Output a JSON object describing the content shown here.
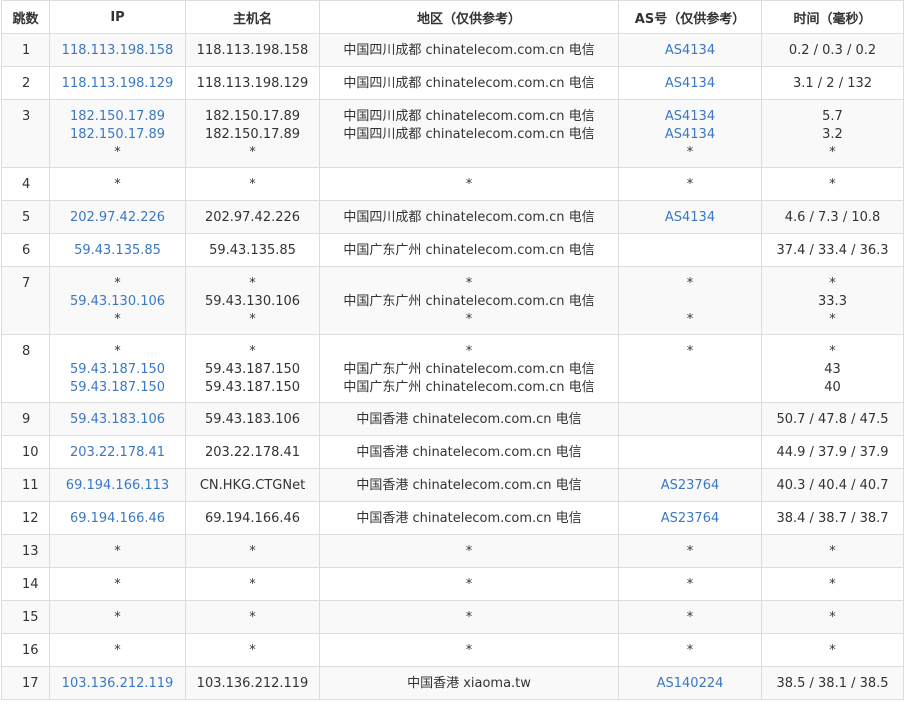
{
  "columns": [
    "跳数",
    "IP",
    "主机名",
    "地区（仅供参考）",
    "AS号（仅供参考）",
    "时间（毫秒）"
  ],
  "rows": [
    {
      "hop": "1",
      "ip": [
        "118.113.198.158"
      ],
      "host": [
        "118.113.198.158"
      ],
      "region": [
        "中国四川成都 chinatelecom.com.cn 电信"
      ],
      "as": [
        "AS4134"
      ],
      "time": [
        "0.2 / 0.3 / 0.2"
      ]
    },
    {
      "hop": "2",
      "ip": [
        "118.113.198.129"
      ],
      "host": [
        "118.113.198.129"
      ],
      "region": [
        "中国四川成都 chinatelecom.com.cn 电信"
      ],
      "as": [
        "AS4134"
      ],
      "time": [
        "3.1 / 2 / 132"
      ]
    },
    {
      "hop": "3",
      "ip": [
        "182.150.17.89",
        "182.150.17.89",
        "*"
      ],
      "host": [
        "182.150.17.89",
        "182.150.17.89",
        "*"
      ],
      "region": [
        "中国四川成都 chinatelecom.com.cn 电信",
        "中国四川成都 chinatelecom.com.cn 电信",
        ""
      ],
      "as": [
        "AS4134",
        "AS4134",
        "*"
      ],
      "time": [
        "5.7",
        "3.2",
        "*"
      ]
    },
    {
      "hop": "4",
      "ip": [
        "*"
      ],
      "host": [
        "*"
      ],
      "region": [
        "*"
      ],
      "as": [
        "*"
      ],
      "time": [
        "*"
      ]
    },
    {
      "hop": "5",
      "ip": [
        "202.97.42.226"
      ],
      "host": [
        "202.97.42.226"
      ],
      "region": [
        "中国四川成都 chinatelecom.com.cn 电信"
      ],
      "as": [
        "AS4134"
      ],
      "time": [
        "4.6 / 7.3 / 10.8"
      ]
    },
    {
      "hop": "6",
      "ip": [
        "59.43.135.85"
      ],
      "host": [
        "59.43.135.85"
      ],
      "region": [
        "中国广东广州 chinatelecom.com.cn 电信"
      ],
      "as": [
        ""
      ],
      "time": [
        "37.4 / 33.4 / 36.3"
      ]
    },
    {
      "hop": "7",
      "ip": [
        "*",
        "59.43.130.106",
        "*"
      ],
      "host": [
        "*",
        "59.43.130.106",
        "*"
      ],
      "region": [
        "*",
        "中国广东广州 chinatelecom.com.cn 电信",
        "*"
      ],
      "as": [
        "*",
        "",
        "*"
      ],
      "time": [
        "*",
        "33.3",
        "*"
      ]
    },
    {
      "hop": "8",
      "ip": [
        "*",
        "59.43.187.150",
        "59.43.187.150"
      ],
      "host": [
        "*",
        "59.43.187.150",
        "59.43.187.150"
      ],
      "region": [
        "*",
        "中国广东广州 chinatelecom.com.cn 电信",
        "中国广东广州 chinatelecom.com.cn 电信"
      ],
      "as": [
        "*",
        "",
        ""
      ],
      "time": [
        "*",
        "43",
        "40"
      ]
    },
    {
      "hop": "9",
      "ip": [
        "59.43.183.106"
      ],
      "host": [
        "59.43.183.106"
      ],
      "region": [
        "中国香港 chinatelecom.com.cn 电信"
      ],
      "as": [
        ""
      ],
      "time": [
        "50.7 / 47.8 / 47.5"
      ]
    },
    {
      "hop": "10",
      "ip": [
        "203.22.178.41"
      ],
      "host": [
        "203.22.178.41"
      ],
      "region": [
        "中国香港 chinatelecom.com.cn 电信"
      ],
      "as": [
        ""
      ],
      "time": [
        "44.9 / 37.9 / 37.9"
      ]
    },
    {
      "hop": "11",
      "ip": [
        "69.194.166.113"
      ],
      "host": [
        "CN.HKG.CTGNet"
      ],
      "region": [
        "中国香港 chinatelecom.com.cn 电信"
      ],
      "as": [
        "AS23764"
      ],
      "time": [
        "40.3 / 40.4 / 40.7"
      ]
    },
    {
      "hop": "12",
      "ip": [
        "69.194.166.46"
      ],
      "host": [
        "69.194.166.46"
      ],
      "region": [
        "中国香港 chinatelecom.com.cn 电信"
      ],
      "as": [
        "AS23764"
      ],
      "time": [
        "38.4 / 38.7 / 38.7"
      ]
    },
    {
      "hop": "13",
      "ip": [
        "*"
      ],
      "host": [
        "*"
      ],
      "region": [
        "*"
      ],
      "as": [
        "*"
      ],
      "time": [
        "*"
      ]
    },
    {
      "hop": "14",
      "ip": [
        "*"
      ],
      "host": [
        "*"
      ],
      "region": [
        "*"
      ],
      "as": [
        "*"
      ],
      "time": [
        "*"
      ]
    },
    {
      "hop": "15",
      "ip": [
        "*"
      ],
      "host": [
        "*"
      ],
      "region": [
        "*"
      ],
      "as": [
        "*"
      ],
      "time": [
        "*"
      ]
    },
    {
      "hop": "16",
      "ip": [
        "*"
      ],
      "host": [
        "*"
      ],
      "region": [
        "*"
      ],
      "as": [
        "*"
      ],
      "time": [
        "*"
      ]
    },
    {
      "hop": "17",
      "ip": [
        "103.136.212.119"
      ],
      "host": [
        "103.136.212.119"
      ],
      "region": [
        "中国香港 xiaoma.tw"
      ],
      "as": [
        "AS140224"
      ],
      "time": [
        "38.5 / 38.1 / 38.5"
      ]
    }
  ],
  "colors": {
    "link": "#3b78c3",
    "border": "#dddddd",
    "stripe": "#f9f9f9",
    "text": "#333333"
  }
}
